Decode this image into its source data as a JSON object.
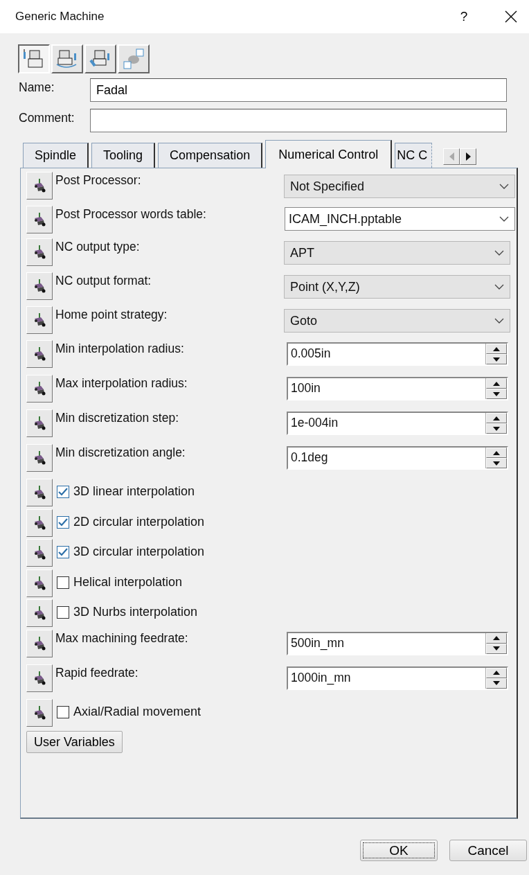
{
  "window": {
    "title": "Generic Machine",
    "help": "?"
  },
  "toolbar": [
    {
      "selected": true
    },
    {
      "selected": false
    },
    {
      "selected": false
    },
    {
      "selected": false
    }
  ],
  "name": {
    "label": "Name:",
    "value": "Fadal"
  },
  "comment": {
    "label": "Comment:"
  },
  "tabs": [
    {
      "label": "Spindle",
      "selected": false
    },
    {
      "label": "Tooling",
      "selected": false
    },
    {
      "label": "Compensation",
      "selected": false
    },
    {
      "label": "Numerical Control",
      "selected": true
    },
    {
      "label": "NC C",
      "selected": false
    }
  ],
  "tab_scroll": [
    {
      "kind": "left",
      "disabled": true
    },
    {
      "kind": "right",
      "disabled": false
    }
  ],
  "settings": [
    {
      "kind": "select",
      "label": "Post Processor:",
      "value": "Not Specified"
    },
    {
      "kind": "combo",
      "label": "Post Processor words table:",
      "value": "ICAM_INCH.pptable"
    },
    {
      "kind": "select",
      "label": "NC output type:",
      "value": "APT"
    },
    {
      "kind": "select",
      "label": "NC output format:",
      "value": "Point (X,Y,Z)"
    },
    {
      "kind": "select",
      "label": "Home point strategy:",
      "value": "Goto"
    },
    {
      "kind": "spin",
      "label": "Min interpolation radius:",
      "value": "0.005in"
    },
    {
      "kind": "spin",
      "label": "Max interpolation radius:",
      "value": "100in"
    },
    {
      "kind": "spin",
      "label": "Min discretization step:",
      "value": "1e-004in"
    },
    {
      "kind": "spin",
      "label": "Min discretization angle:",
      "value": "0.1deg"
    },
    {
      "kind": "check",
      "label": "3D linear interpolation",
      "checked": true
    },
    {
      "kind": "check",
      "label": "2D circular interpolation",
      "checked": true
    },
    {
      "kind": "check",
      "label": "3D circular interpolation",
      "checked": true
    },
    {
      "kind": "check",
      "label": "Helical interpolation",
      "checked": false
    },
    {
      "kind": "check",
      "label": "3D Nurbs interpolation",
      "checked": false
    },
    {
      "kind": "spin",
      "label": "Max machining feedrate:",
      "value": "500in_mn"
    },
    {
      "kind": "spin",
      "label": "Rapid feedrate:",
      "value": "1000in_mn"
    },
    {
      "kind": "check",
      "label": "Axial/Radial movement",
      "checked": false
    }
  ],
  "user_variables_button": "User Variables",
  "footer_buttons": [
    {
      "label": "OK",
      "focused": true
    },
    {
      "label": "Cancel",
      "focused": false
    }
  ]
}
